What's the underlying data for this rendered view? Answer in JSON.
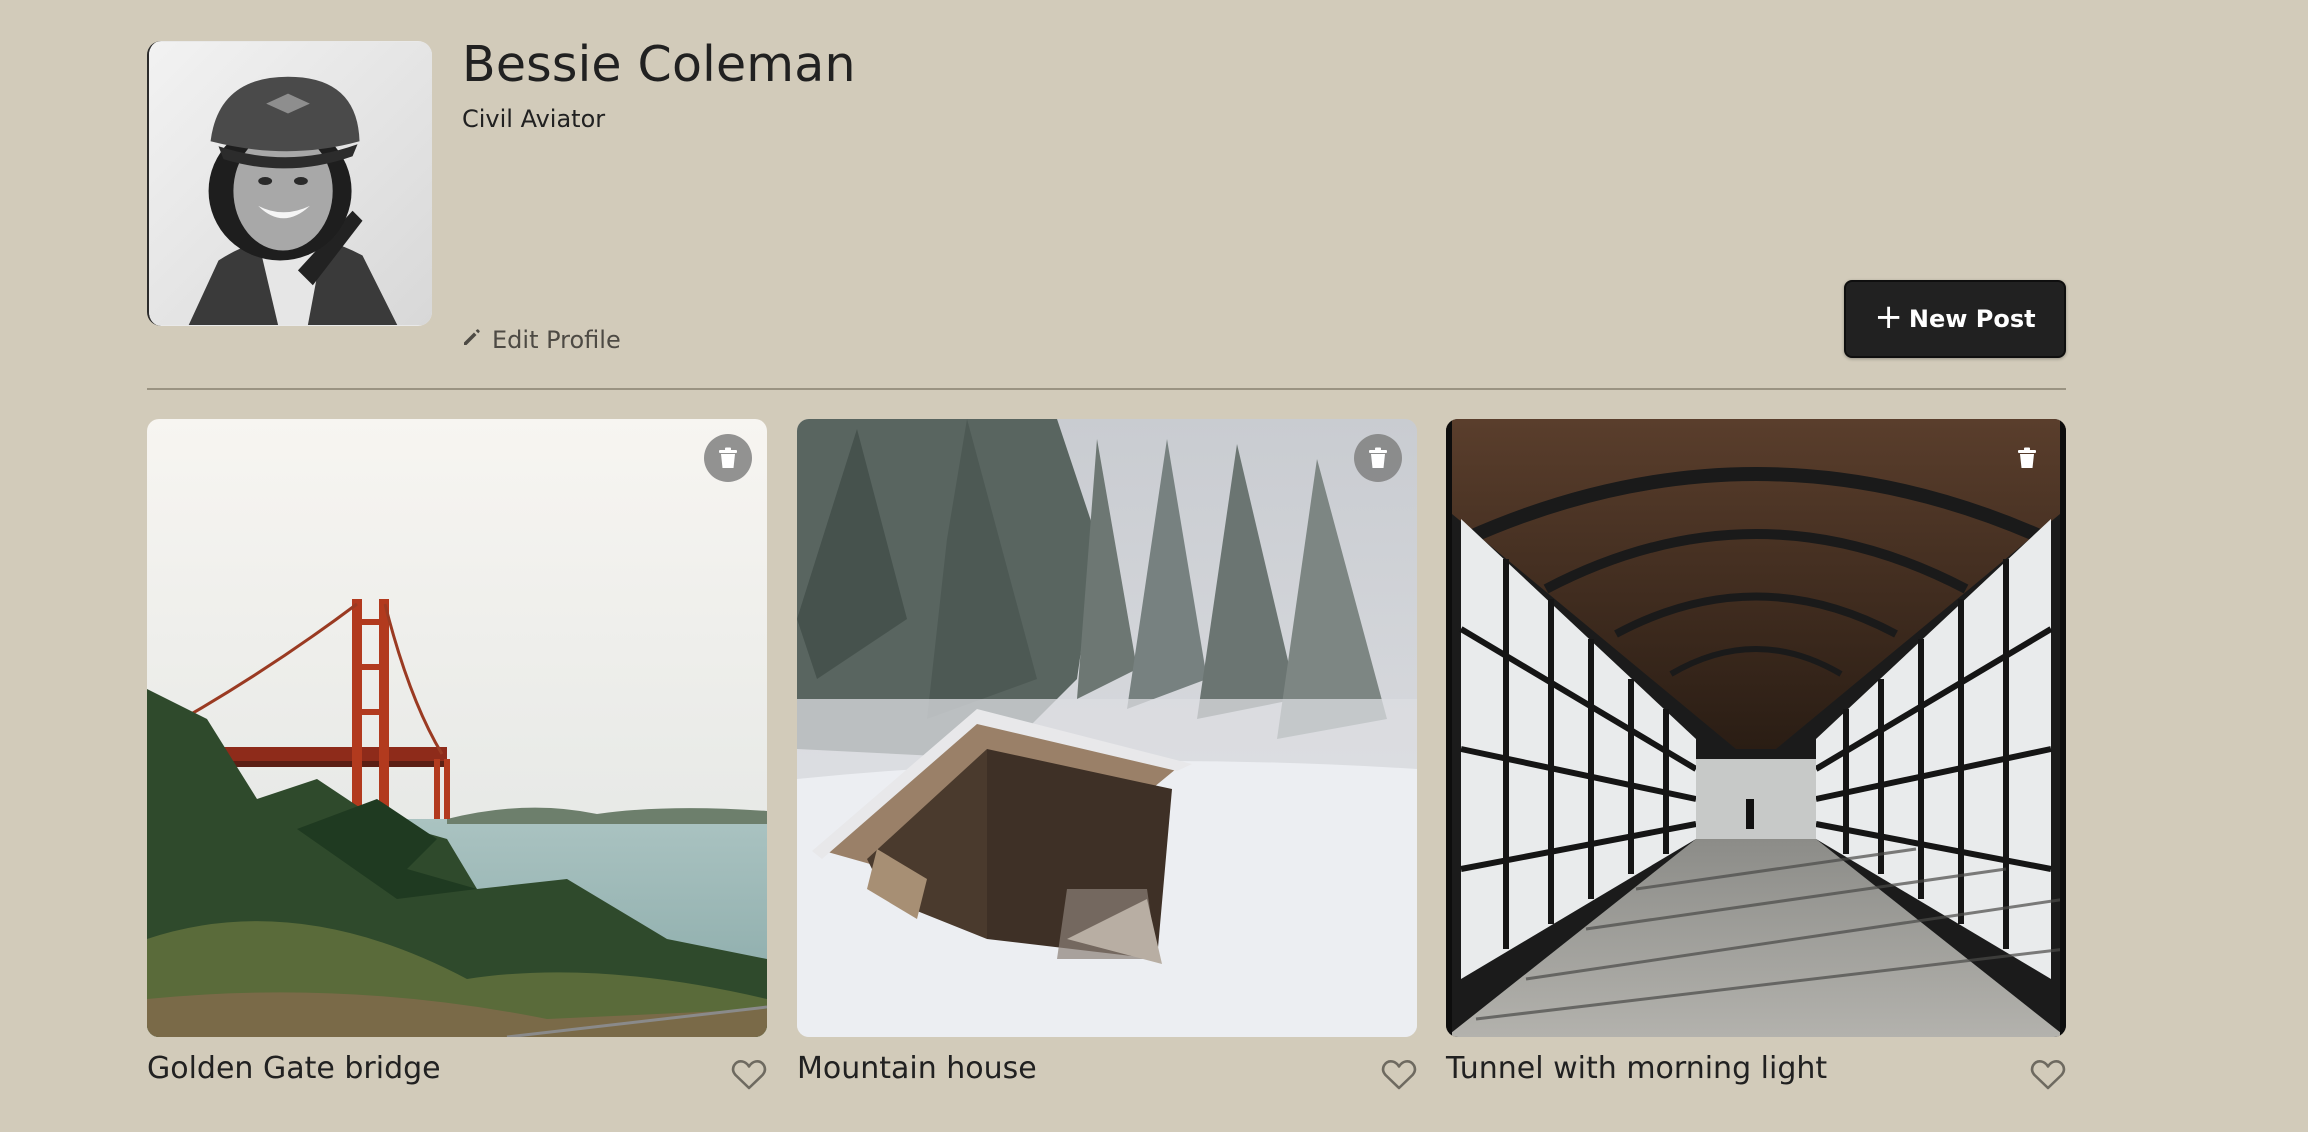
{
  "profile": {
    "name": "Bessie Coleman",
    "job": "Civil Aviator",
    "edit_label": "Edit Profile"
  },
  "toolbar": {
    "new_post_label": "New Post"
  },
  "icons": {
    "edit": "pencil-icon",
    "add": "plus-icon",
    "delete": "trash-icon",
    "like": "heart-icon"
  },
  "colors": {
    "background": "#d2cbba",
    "text": "#212121",
    "button": "#212121"
  },
  "cards": [
    {
      "title": "Golden Gate bridge",
      "liked": false
    },
    {
      "title": "Mountain house",
      "liked": false
    },
    {
      "title": "Tunnel with morning light",
      "liked": false
    }
  ]
}
